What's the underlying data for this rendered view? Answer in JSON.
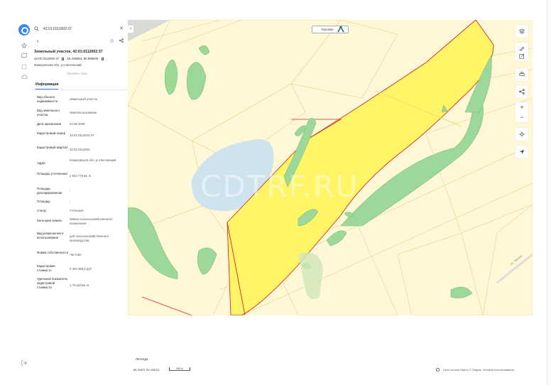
{
  "search": {
    "value": "42:01:0112002:37"
  },
  "parcel": {
    "title": "Земельный участок, 42:01:0112002:37",
    "number": "42:01:0112002:37",
    "coords": "54.435854, 86.899949",
    "region": "Кемеровская обл, р-н Беловский",
    "get_plan": "Получить план"
  },
  "tabs": [
    {
      "label": "Информация"
    }
  ],
  "info": [
    {
      "label": "Вид объекта недвижимости",
      "value": "Земельный участок"
    },
    {
      "label": "Вид земельного участка",
      "value": "Землепользование"
    },
    {
      "label": "Дата присвоения",
      "value": "04.08.2009"
    },
    {
      "label": "Кадастровый номер",
      "value": "42:01:0112002:37"
    },
    {
      "label": "Кадастровый квартал",
      "value": "42:01:0112002"
    },
    {
      "label": "Адрес",
      "value": "Кемеровская обл, р-н Беловский"
    },
    {
      "label": "Площадь уточненная",
      "value": "1 944 776 кв. м"
    },
    {
      "label": "Площадь декларированная",
      "value": "-"
    },
    {
      "label": "Площадь",
      "value": "-"
    },
    {
      "label": "Статус",
      "value": "Учтенный"
    },
    {
      "label": "Категория земель",
      "value": "Земли сельскохозяйственного назначения"
    },
    {
      "label": "Вид разрешенного использования",
      "value": "для сельскохозяйственного производства"
    },
    {
      "label": "Форма собственности",
      "value": "Частная"
    },
    {
      "label": "Кадастровая стоимость",
      "value": "3 403 358,5 руб."
    },
    {
      "label": "Удельный показатель кадастровой стоимости",
      "value": "1,75 руб/кв. м"
    }
  ],
  "map": {
    "watermark": "CDTRF.RU",
    "plot_badge": "Торговая",
    "road_label": "ул. Фрунзе",
    "colors": {
      "parcel": "#fff566",
      "forest": "#9ed79a",
      "water": "#cfe3ef",
      "field": "#fff8d6",
      "boundary": "#d62a2a"
    }
  },
  "bottom": {
    "legend": "Легенда",
    "coords": "86.3930Т   54.435021",
    "scale": "200 м",
    "attribution": "Open-source    Карты © Яндекс   Условия использования"
  },
  "icons": [
    "logo-icon",
    "star-outline-icon",
    "map-icon",
    "layers-icon",
    "cloud-icon",
    "search-icon",
    "close-icon",
    "back-arrow-icon",
    "star-icon",
    "share-icon",
    "layers-toggle-icon",
    "pencil-icon",
    "edit-icon",
    "print-icon",
    "share-route-icon",
    "zoom-in-icon",
    "zoom-out-icon",
    "locate-icon",
    "compass-icon",
    "login-icon"
  ]
}
